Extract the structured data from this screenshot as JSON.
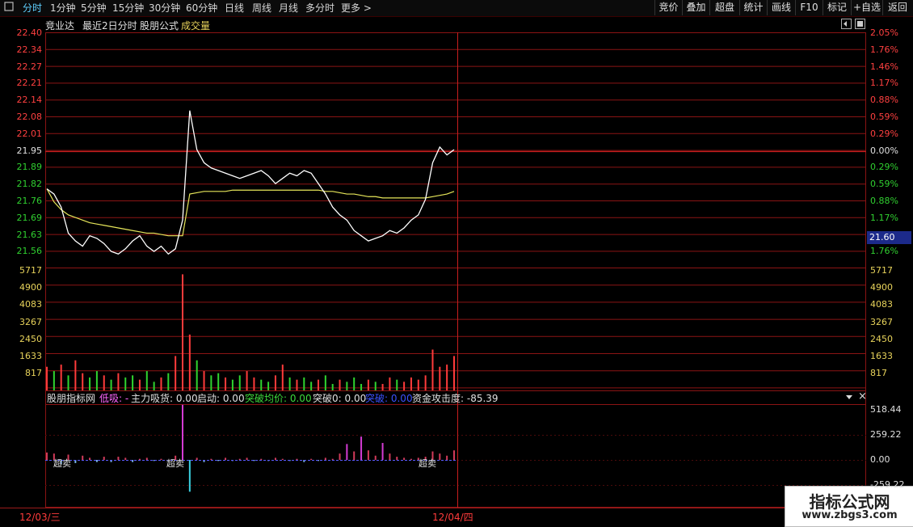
{
  "toolbar": {
    "menu_icon": "menu-square-icon",
    "tabs": [
      "分时",
      "1分钟",
      "5分钟",
      "15分钟",
      "30分钟",
      "60分钟",
      "日线",
      "周线",
      "月线",
      "多分时",
      "更多 >"
    ],
    "active": "分时",
    "right_buttons": [
      "竞价",
      "叠加",
      "超盘",
      "统计",
      "画线",
      "F10",
      "标记",
      "+自选",
      "返回"
    ]
  },
  "header": {
    "name": "竞业达",
    "mode": "最近2日分时",
    "formula": "股朋公式",
    "volume": "成交量",
    "icons": [
      "reset-icon",
      "square-icon"
    ]
  },
  "colors": {
    "up": "#ff3b3b",
    "down": "#2fd52f",
    "grid": "#8b1414",
    "price": "#ffffff",
    "avg": "#e6e65a",
    "vol_label": "#e8d35b"
  },
  "price_axis": {
    "left": [
      "22.40",
      "22.34",
      "22.27",
      "22.21",
      "22.14",
      "22.08",
      "22.01",
      "21.95",
      "21.89",
      "21.82",
      "21.76",
      "21.69",
      "21.63",
      "21.56"
    ],
    "right": [
      "2.05%",
      "1.76%",
      "1.46%",
      "1.17%",
      "0.88%",
      "0.59%",
      "0.29%",
      "0.00%",
      "0.29%",
      "0.59%",
      "0.88%",
      "1.17%",
      "1.46%",
      "1.76%"
    ],
    "current": "21.60"
  },
  "volume_axis": [
    "5717",
    "4900",
    "4083",
    "3267",
    "2450",
    "1633",
    "817"
  ],
  "indicator": {
    "name": "股朋指标网",
    "items": [
      {
        "label": "低吸: -",
        "color": "#ff66ff"
      },
      {
        "label": "主力吸货: 0.00",
        "color": "#e0e0e0"
      },
      {
        "label": "启动: 0.00",
        "color": "#e0e0e0"
      },
      {
        "label": "突破均价: 0.00",
        "color": "#3ddc3d"
      },
      {
        "label": "突破0: 0.00",
        "color": "#e0e0e0"
      },
      {
        "label": "突破: 0.00",
        "color": "#3b52ff"
      },
      {
        "label": "资金攻击度: -85.39",
        "color": "#e0e0e0"
      }
    ],
    "axis": [
      "518.44",
      "259.22",
      "0.00",
      "-259.22"
    ],
    "markers": [
      "超卖",
      "超卖",
      "超卖"
    ],
    "controls": [
      "dropdown-icon",
      "close-icon"
    ]
  },
  "dates": [
    "12/03/三",
    "12/04/四"
  ],
  "watermark": {
    "title": "指标公式网",
    "url": "www.zbgs3.com"
  },
  "chart_data": {
    "type": "line",
    "series": [
      {
        "values": [
          21.8,
          21.78,
          21.73,
          21.63,
          21.6,
          21.58,
          21.62,
          21.61,
          21.59,
          21.56,
          21.55,
          21.57,
          21.6,
          21.62,
          21.58,
          21.56,
          21.58,
          21.55,
          21.57,
          21.68,
          22.1,
          21.95,
          21.9,
          21.88,
          21.87,
          21.86,
          21.85,
          21.84,
          21.85,
          21.86,
          21.87,
          21.85,
          21.82,
          21.84,
          21.86,
          21.85,
          21.87,
          21.86,
          21.82,
          21.78,
          21.73,
          21.7,
          21.68,
          21.64,
          21.62,
          21.6,
          21.61,
          21.62,
          21.64,
          21.63,
          21.65,
          21.68,
          21.7,
          21.76,
          21.9,
          21.96,
          21.93,
          21.95
        ]
      },
      {
        "values": [
          21.8,
          21.75,
          21.72,
          21.7,
          21.69,
          21.68,
          21.67,
          21.665,
          21.66,
          21.655,
          21.65,
          21.645,
          21.64,
          21.635,
          21.63,
          21.63,
          21.625,
          21.62,
          21.62,
          21.62,
          21.78,
          21.785,
          21.79,
          21.79,
          21.79,
          21.79,
          21.795,
          21.795,
          21.795,
          21.795,
          21.795,
          21.795,
          21.795,
          21.795,
          21.795,
          21.795,
          21.795,
          21.795,
          21.795,
          21.79,
          21.79,
          21.785,
          21.78,
          21.78,
          21.775,
          21.77,
          21.77,
          21.765,
          21.765,
          21.765,
          21.765,
          21.765,
          21.765,
          21.765,
          21.77,
          21.775,
          21.78,
          21.79
        ]
      }
    ],
    "volumes": [
      1100,
      900,
      1200,
      700,
      1400,
      800,
      600,
      900,
      700,
      500,
      800,
      600,
      700,
      500,
      900,
      400,
      600,
      800,
      1600,
      5400,
      2600,
      1400,
      900,
      700,
      800,
      600,
      500,
      700,
      900,
      600,
      500,
      400,
      700,
      1200,
      600,
      500,
      600,
      400,
      500,
      700,
      300,
      500,
      400,
      600,
      300,
      500,
      400,
      300,
      600,
      500,
      400,
      600,
      500,
      700,
      1900,
      1100,
      1200,
      1600
    ],
    "volume_up": [
      1,
      0,
      1,
      0,
      1,
      1,
      0,
      0,
      1,
      0,
      1,
      0,
      0,
      1,
      0,
      0,
      1,
      0,
      1,
      1,
      1,
      0,
      1,
      0,
      0,
      1,
      0,
      0,
      1,
      1,
      0,
      0,
      1,
      1,
      0,
      1,
      0,
      0,
      1,
      0,
      0,
      1,
      0,
      0,
      0,
      1,
      0,
      1,
      1,
      0,
      1,
      1,
      1,
      1,
      1,
      1,
      1,
      1
    ],
    "indicator_values": [
      70,
      60,
      -40,
      50,
      -30,
      40,
      20,
      -20,
      30,
      -20,
      30,
      20,
      -20,
      10,
      20,
      -10,
      10,
      -10,
      40,
      520,
      -300,
      20,
      -20,
      10,
      -10,
      20,
      -10,
      10,
      20,
      -10,
      10,
      -10,
      20,
      10,
      -10,
      10,
      -20,
      10,
      -10,
      20,
      10,
      60,
      150,
      80,
      220,
      90,
      40,
      160,
      60,
      30,
      20,
      10,
      20,
      30,
      80,
      60,
      40,
      90
    ],
    "ylim": [
      21.5,
      22.4
    ]
  }
}
